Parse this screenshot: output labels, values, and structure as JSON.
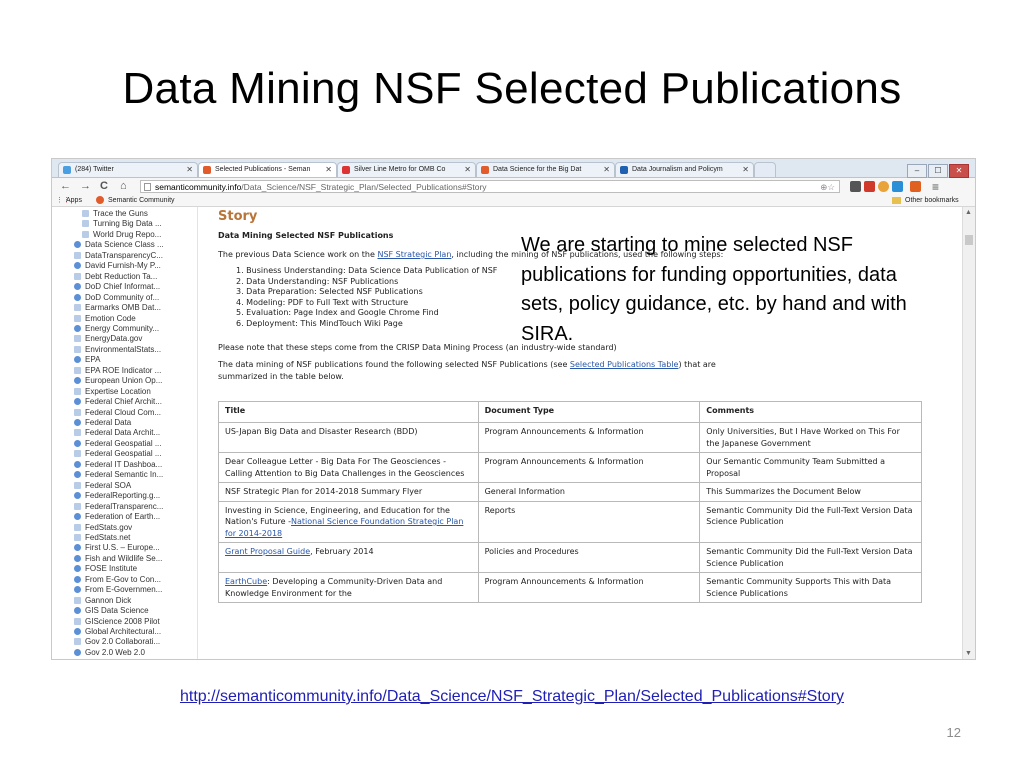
{
  "slide": {
    "title": "Data Mining NSF Selected Publications",
    "callout": "We are starting to mine selected NSF publications for funding opportunities, data sets, policy guidance, etc. by hand and with SIRA.",
    "link": "http://semanticommunity.info/Data_Science/NSF_Strategic_Plan/Selected_Publications#Story",
    "page_number": "12"
  },
  "browser": {
    "tabs": [
      {
        "label": "(284) Twitter",
        "color": "#4a9fe0"
      },
      {
        "label": "Selected Publications - Seman",
        "color": "#e25b2b",
        "active": true
      },
      {
        "label": "Silver Line Metro for OMB Co",
        "color": "#d33"
      },
      {
        "label": "Data Science for the Big Dat",
        "color": "#e25b2b"
      },
      {
        "label": "Data Journalism and Policym",
        "color": "#2060b0"
      }
    ],
    "window_buttons": [
      "–",
      "☐",
      "✕"
    ],
    "nav": {
      "back": "←",
      "forward": "→",
      "reload": "C",
      "home": "⌂"
    },
    "url_host": "semanticommunity.info",
    "url_path": "/Data_Science/NSF_Strategic_Plan/Selected_Publications#Story",
    "bookmarks": {
      "apps": "Apps",
      "semantic": "Semantic Community",
      "other": "Other bookmarks"
    }
  },
  "sidebar": {
    "items": [
      "Trace the Guns",
      "Turning Big Data ...",
      "World Drug Repo...",
      "Data Science Class ...",
      "DataTransparencyC...",
      "David Furnish-My P...",
      "Debt Reduction Ta...",
      "DoD Chief Informat...",
      "DoD Community of...",
      "Earmarks OMB Dat...",
      "Emotion Code",
      "Energy Community...",
      "EnergyData.gov",
      "EnvironmentalStats...",
      "EPA",
      "EPA ROE Indicator ...",
      "European Union Op...",
      "Expertise Location",
      "Federal Chief Archit...",
      "Federal Cloud Com...",
      "Federal Data",
      "Federal Data Archit...",
      "Federal Geospatial ...",
      "Federal Geospatial ...",
      "Federal IT Dashboa...",
      "Federal Semantic In...",
      "Federal SOA",
      "FederalReporting.g...",
      "FederalTransparenc...",
      "Federation of Earth...",
      "FedStats.gov",
      "FedStats.net",
      "First U.S. – Europe...",
      "Fish and Wildlife Se...",
      "FOSE Institute",
      "From E-Gov to Con...",
      "From E-Governmen...",
      "Gannon Dick",
      "GIS Data Science",
      "GIScience 2008 Pilot",
      "Global Architectural...",
      "Gov 2.0 Collaborati...",
      "Gov 2.0 Web 2.0"
    ]
  },
  "page": {
    "heading": "Story",
    "subheading": "Data Mining Selected NSF Publications",
    "intro_before": "The previous Data Science work on the ",
    "intro_link": "NSF Strategic Plan",
    "intro_after": ", including the mining of NSF publications, used the following steps:",
    "steps": [
      "1.  Business Understanding: Data Science Data Publication of NSF",
      "2.  Data Understanding: NSF Publications",
      "3.  Data Preparation: Selected NSF Publications",
      "4.  Modeling: PDF to Full Text with Structure",
      "5.  Evaluation: Page Index and Google Chrome Find",
      "6.  Deployment: This MindTouch Wiki Page"
    ],
    "note": "Please note that these steps come from the CRISP Data Mining Process (an industry-wide standard)",
    "found_before": "The data mining of NSF publications found the following selected NSF Publications (see ",
    "found_link": "Selected Publications Table",
    "found_after": ") that are",
    "found_line2": "summarized in the table below.",
    "table": {
      "headers": [
        "Title",
        "Document Type",
        "Comments"
      ],
      "rows": [
        {
          "title": "US-Japan Big Data and Disaster Research (BDD)",
          "link": "",
          "rest": "",
          "type": "Program Announcements & Information",
          "comment": "Only Universities, But I Have Worked on This For the Japanese Government"
        },
        {
          "title": "Dear Colleague Letter - Big Data For The Geosciences - Calling Attention to Big Data Challenges in the Geosciences",
          "link": "",
          "rest": "",
          "type": "Program Announcements & Information",
          "comment": "Our Semantic Community Team Submitted a Proposal"
        },
        {
          "title": "NSF Strategic Plan for 2014-2018 Summary Flyer",
          "link": "",
          "rest": "",
          "type": "General Information",
          "comment": "This Summarizes the Document Below"
        },
        {
          "title": "Investing in Science, Engineering, and Education for the Nation's Future -",
          "link": "National Science Foundation Strategic Plan for 2014-2018",
          "rest": "",
          "type": "Reports",
          "comment": "Semantic Community Did the Full-Text Version Data Science Publication"
        },
        {
          "title": "",
          "link": "Grant Proposal Guide",
          "rest": ", February 2014",
          "type": "Policies and Procedures",
          "comment": "Semantic Community Did the Full-Text Version Data Science Publication"
        },
        {
          "title": "",
          "link": "EarthCube",
          "rest": ": Developing a Community-Driven Data and Knowledge Environment for the",
          "type": "Program Announcements & Information",
          "comment": "Semantic Community Supports This with Data Science Publications"
        }
      ]
    }
  }
}
